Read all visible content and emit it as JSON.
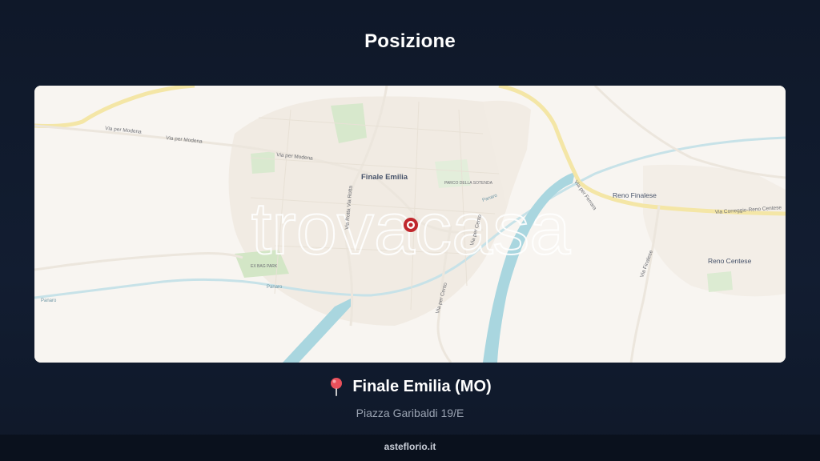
{
  "header": {
    "title": "Posizione"
  },
  "map": {
    "watermark": "trovacasa",
    "labels": {
      "town": "Finale Emilia",
      "reno_finalese": "Reno Finalese",
      "reno_centese": "Reno Centese",
      "via_per_modena_1": "Via per Modena",
      "via_per_modena_2": "Via per Modena",
      "via_per_modena_3": "Via per Modena",
      "via_per_ferrara": "Via per Ferrara",
      "via_correggio": "Via Correggio-Reno Centese",
      "via_finalese": "Via Finalese",
      "via_per_cento": "Via per Cento",
      "via_per_cento_2": "Via per Cento",
      "parco": "PARCO DELLA SOTENDA",
      "ex_bag_park": "EX BAG PARK",
      "panaro": "Panaro",
      "panaro_2": "Panaro",
      "panaro_3": "Panaro",
      "via_rotta": "Via Rotta Via Rotta"
    },
    "colors": {
      "land": "#f8f5f1",
      "water": "#a9d6df",
      "park": "#cfe5c3",
      "road_major": "#f6e7a8",
      "marker": "#c0272d"
    }
  },
  "location": {
    "pin_icon": "map-pin-icon",
    "city": "Finale Emilia (MO)",
    "address": "Piazza Garibaldi 19/E"
  },
  "footer": {
    "site": "asteflorio.it"
  }
}
